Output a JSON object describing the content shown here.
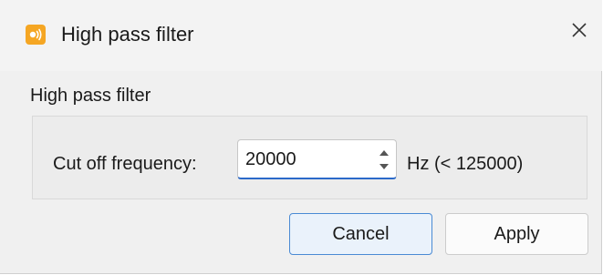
{
  "window": {
    "title": "High pass filter"
  },
  "group": {
    "title": "High pass filter"
  },
  "cutoff": {
    "label": "Cut off frequency:",
    "value": "20000",
    "unit_hint": "Hz (< 125000)"
  },
  "buttons": {
    "cancel": "Cancel",
    "apply": "Apply"
  },
  "colors": {
    "app_icon": "#f5a623",
    "focus_accent": "#2b6ac9",
    "default_button_border": "#4a8ad4"
  },
  "icons": {
    "app": "speaker-icon",
    "close": "close-icon",
    "spin_up": "chevron-up-icon",
    "spin_down": "chevron-down-icon"
  }
}
